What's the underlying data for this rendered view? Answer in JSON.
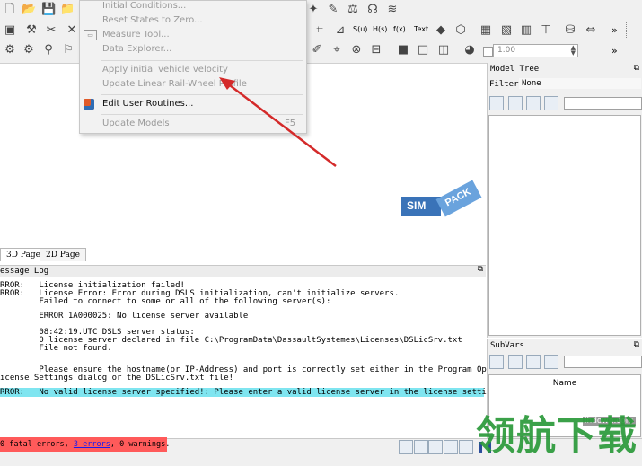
{
  "toolbar": {
    "text_label": "Text",
    "s_label": "S(u)",
    "h_label": "H(s)",
    "f_label": "f(x)",
    "zoom_value": "1.00",
    "more": "»"
  },
  "menu": {
    "items": [
      {
        "label": "Initial Conditions...",
        "enabled": false
      },
      {
        "label": "Reset States to Zero...",
        "enabled": false
      },
      {
        "label": "Measure Tool...",
        "enabled": false
      },
      {
        "label": "Data Explorer...",
        "enabled": false
      },
      {
        "label": "Apply initial vehicle velocity",
        "enabled": false
      },
      {
        "label": "Update Linear Rail-Wheel Profile",
        "enabled": false
      },
      {
        "label": "Edit User Routines...",
        "enabled": true
      },
      {
        "label": "Update Models",
        "enabled": false,
        "shortcut": "F5"
      }
    ]
  },
  "logo": {
    "sim": "SIM",
    "pack": "PACK"
  },
  "tabs": [
    "3D Page",
    "2D Page"
  ],
  "message_log": {
    "title": "essage Log",
    "lines": [
      "RROR:   License initialization failed!",
      "RROR:   License Error: Error during DSLS initialization, can't initialize servers.",
      "        Failed to connect to some or all of the following server(s):",
      "",
      "        ERROR 1A000025: No license server available",
      "",
      "        08:42:19.UTC DSLS server status:",
      "        0 license server declared in file C:\\ProgramData\\DassaultSystemes\\Licenses\\DSLicSrv.txt",
      "        File not found.",
      "",
      "",
      "        Please ensure the hostname(or IP-Address) and port is correctly set either in the Program Options,",
      "icense Settings dialog or the DSLicSrv.txt file!",
      ""
    ],
    "highlight": "RROR:   No valid license server specified!: Please enter a valid license server in the license settings!"
  },
  "status": {
    "fatal": "0 fatal errors, ",
    "errors": "3 errors",
    "rest": ", 0 warnings."
  },
  "model_tree": {
    "title": "Model Tree",
    "filter_label": "Filter:",
    "filter_value": "None"
  },
  "subvars": {
    "title": "SubVars",
    "col_name": "Name"
  },
  "watermark": {
    "site": "lhdown.com",
    "text": "领航下载"
  },
  "colors": {
    "highlight": "#7fe5f0",
    "status_bar": "#ff5a5a",
    "arrow": "#d42a2a",
    "logo_blue": "#3a73b8",
    "logo_light": "#6aa3dd"
  }
}
